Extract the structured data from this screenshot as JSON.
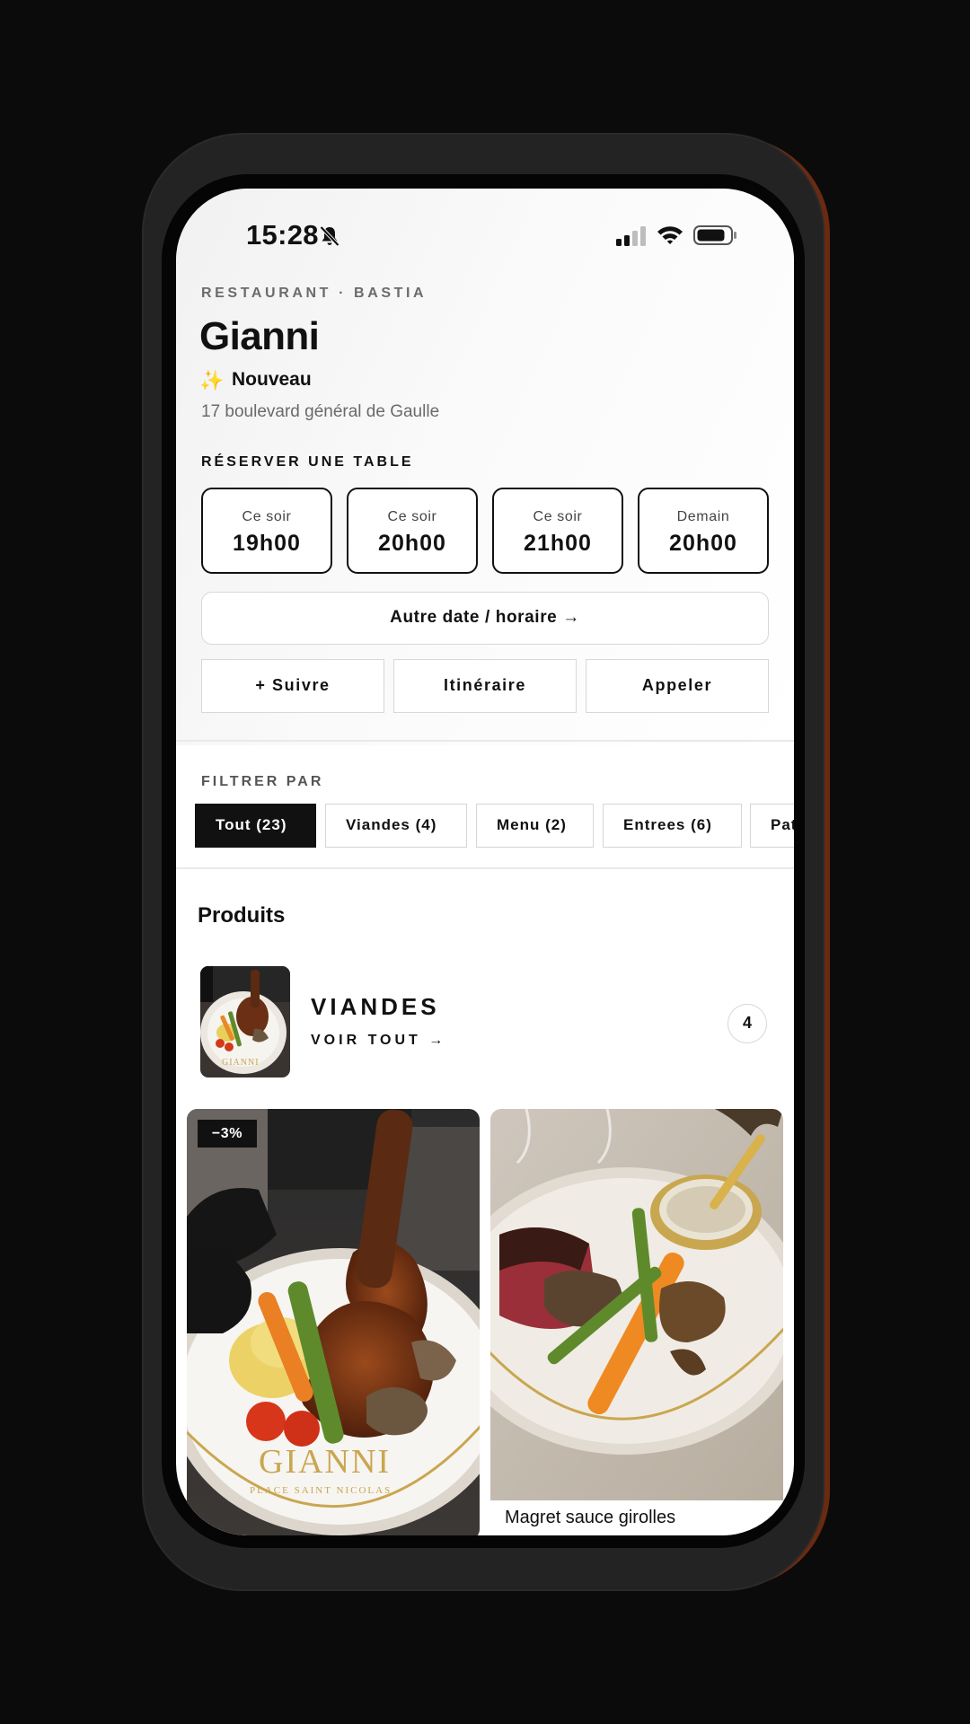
{
  "status_bar": {
    "time": "15:28"
  },
  "restaurant": {
    "kicker": "RESTAURANT · BASTIA",
    "name": "Gianni",
    "badge_emoji": "✨",
    "badge": "Nouveau",
    "address": "17 boulevard général de Gaulle"
  },
  "reservation": {
    "label": "RÉSERVER UNE TABLE",
    "slots": [
      {
        "day": "Ce soir",
        "time": "19h00"
      },
      {
        "day": "Ce soir",
        "time": "20h00"
      },
      {
        "day": "Ce soir",
        "time": "21h00"
      },
      {
        "day": "Demain",
        "time": "20h00"
      }
    ],
    "other_label": "Autre date / horaire →"
  },
  "actions": {
    "follow": "+ Suivre",
    "directions": "Itinéraire",
    "call": "Appeler"
  },
  "filters": {
    "label": "FILTRER PAR",
    "chips": [
      "Tout (23)",
      "Viandes (4)",
      "Menu (2)",
      "Entrees (6)",
      "Pat"
    ],
    "active_index": 0
  },
  "products": {
    "title": "Produits",
    "category": {
      "name": "VIANDES",
      "link": "VOIR TOUT →",
      "count": "4",
      "plate_text": "GIANNI"
    },
    "cards": [
      {
        "discount": "−3%",
        "plate_text": "GIANNI",
        "plate_subtext": "PLACE SAINT NICOLAS"
      },
      {
        "title": "Magret sauce girolles"
      }
    ]
  },
  "colors": {
    "accent": "#111111",
    "phone_frame": "#232323",
    "border_light": "#d8d8d8"
  }
}
